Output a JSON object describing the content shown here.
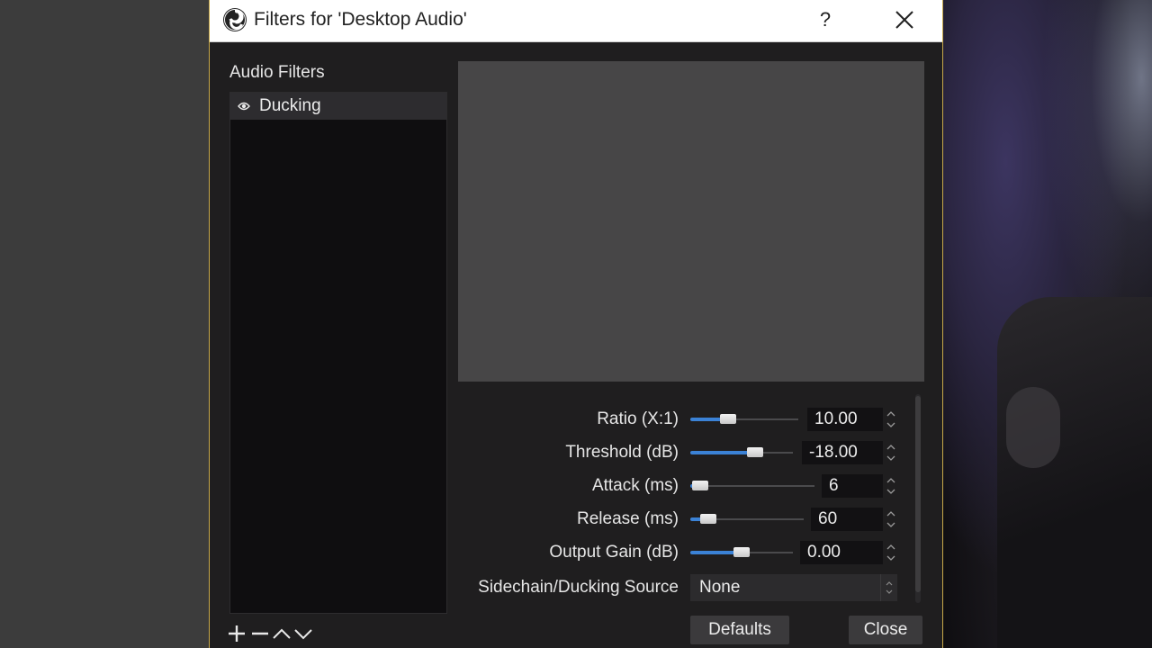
{
  "window": {
    "title": "Filters for 'Desktop Audio'",
    "help_label": "?"
  },
  "filters_panel": {
    "label": "Audio Filters",
    "items": [
      {
        "label": "Ducking",
        "visible": true
      }
    ]
  },
  "properties": [
    {
      "label": "Ratio (X:1)",
      "value": "10.00",
      "slider_fraction": 0.32
    },
    {
      "label": "Threshold (dB)",
      "value": "-18.00",
      "slider_fraction": 0.66
    },
    {
      "label": "Attack (ms)",
      "value": "6",
      "slider_fraction": 0.02
    },
    {
      "label": "Release (ms)",
      "value": "60",
      "slider_fraction": 0.1
    },
    {
      "label": "Output Gain (dB)",
      "value": "0.00",
      "slider_fraction": 0.5
    }
  ],
  "sidechain": {
    "label": "Sidechain/Ducking Source",
    "value": "None"
  },
  "buttons": {
    "defaults": "Defaults",
    "close": "Close"
  },
  "colors": {
    "accent": "#3b82d6",
    "window_border": "#c8a94a"
  },
  "icons": {
    "app": "obs-logo-icon",
    "close": "close-icon",
    "visibility": "eye-icon",
    "add": "plus-icon",
    "remove": "minus-icon",
    "move_up": "chevron-up-icon",
    "move_down": "chevron-down-icon"
  }
}
